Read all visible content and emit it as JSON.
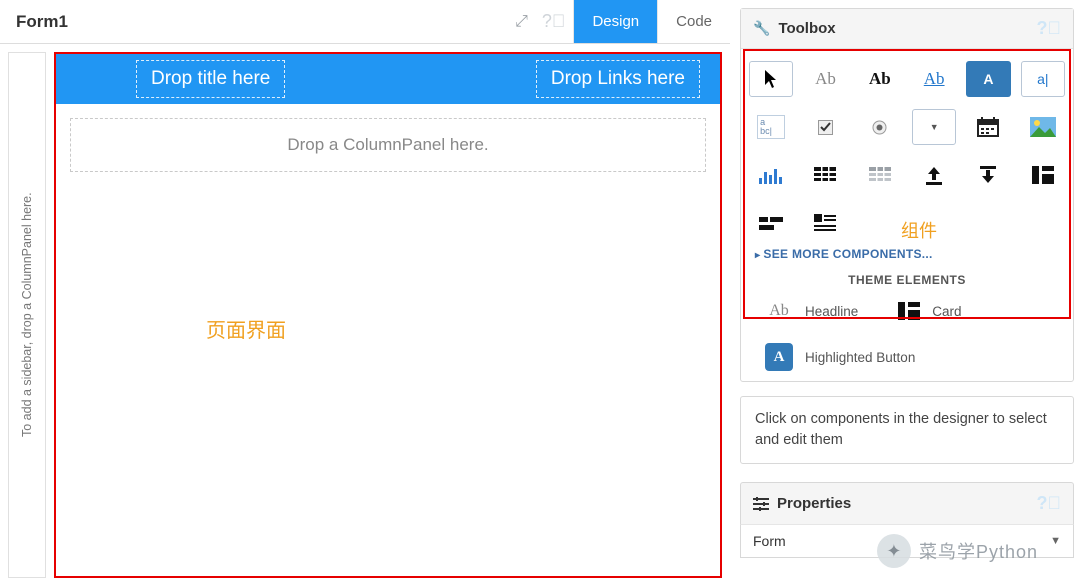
{
  "header": {
    "form_title": "Form1",
    "tab_design": "Design",
    "tab_code": "Code"
  },
  "designer": {
    "sidebar_hint": "To add a sidebar, drop a ColumnPanel here.",
    "drop_title": "Drop title here",
    "drop_links": "Drop Links here",
    "drop_column": "Drop a ColumnPanel here.",
    "page_annotation": "页面界面"
  },
  "toolbox": {
    "title": "Toolbox",
    "components_annotation": "组件",
    "see_more": "SEE MORE COMPONENTS...",
    "theme_section": "THEME ELEMENTS",
    "theme_items": {
      "headline": "Headline",
      "card": "Card",
      "highlighted_button": "Highlighted Button"
    },
    "hint": "Click on components in the designer to select and edit them",
    "tools": {
      "label_ab": "Ab",
      "bold_ab": "Ab",
      "link_ab": "Ab",
      "button_A": "A",
      "textbox_a": "a|",
      "textarea_a": "a",
      "textarea_bc": "bc|"
    }
  },
  "properties": {
    "title": "Properties",
    "selected": "Form"
  },
  "watermark": "菜鸟学Python"
}
